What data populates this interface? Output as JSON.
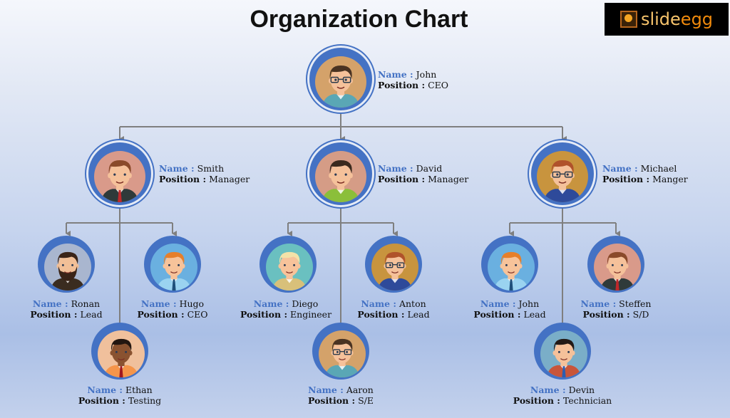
{
  "title": "Organization Chart",
  "logo": {
    "part1": "slide",
    "part2": "egg"
  },
  "labels": {
    "name": "Name :",
    "position": "Position :"
  },
  "colors": {
    "accent": "#4472c4",
    "connector": "#7f7f7f"
  },
  "people": [
    {
      "id": "ceo",
      "name": "John",
      "position": "CEO",
      "level": 0,
      "face": "#d4a26a",
      "shirt": "#5aa7b5",
      "hair": "#4a3322",
      "skin": "#f5c19a",
      "glasses": true
    },
    {
      "id": "m1",
      "name": "Smith",
      "position": "Manager",
      "level": 1,
      "face": "#d99a8a",
      "shirt": "#2f3a3a",
      "hair": "#8a4a2a",
      "skin": "#f5c19a",
      "tie": "#c0282b"
    },
    {
      "id": "m2",
      "name": "David",
      "position": "Manager",
      "level": 1,
      "face": "#d59c86",
      "shirt": "#8bbf3a",
      "hair": "#3b2a1e",
      "skin": "#f5c19a"
    },
    {
      "id": "m3",
      "name": "Michael",
      "position": "Manger",
      "level": 1,
      "face": "#c8943e",
      "shirt": "#2e4a9a",
      "hair": "#b0522a",
      "skin": "#f5c19a",
      "glasses": true
    },
    {
      "id": "r1",
      "name": "Ronan",
      "position": "Lead",
      "level": 2,
      "face": "#a9b6cf",
      "shirt": "#3a2c20",
      "hair": "#3a2418",
      "skin": "#f1bf97",
      "beard": true
    },
    {
      "id": "h1",
      "name": "Hugo",
      "position": "CEO",
      "level": 2,
      "face": "#6ab0e0",
      "shirt": "#9ad3f0",
      "hair": "#e67f2a",
      "skin": "#f7c39a",
      "tie": "#1e4f7a"
    },
    {
      "id": "e1",
      "name": "Ethan",
      "position": "Testing",
      "level": 3,
      "face": "#f0c09c",
      "shirt": "#f5954a",
      "hair": "#231610",
      "skin": "#8a5230",
      "tie": "#a01820"
    },
    {
      "id": "d1",
      "name": "Diego",
      "position": "Engineer",
      "level": 2,
      "face": "#6ac0c0",
      "shirt": "#d8c07a",
      "hair": "#f3e2a8",
      "skin": "#f7c39a"
    },
    {
      "id": "a1",
      "name": "Anton",
      "position": "Lead",
      "level": 2,
      "face": "#c8943e",
      "shirt": "#2e4a9a",
      "hair": "#b0522a",
      "skin": "#f5c19a",
      "glasses": true
    },
    {
      "id": "a2",
      "name": "Aaron",
      "position": "S/E",
      "level": 3,
      "face": "#d4a26a",
      "shirt": "#5aa7b5",
      "hair": "#4a3322",
      "skin": "#f5c19a",
      "glasses": true
    },
    {
      "id": "j2",
      "name": "John",
      "position": "Lead",
      "level": 2,
      "face": "#6ab0e0",
      "shirt": "#9ad3f0",
      "hair": "#e67f2a",
      "skin": "#f7c39a",
      "tie": "#1e4f7a"
    },
    {
      "id": "s1",
      "name": "Steffen",
      "position": "S/D",
      "level": 2,
      "face": "#d99a8a",
      "shirt": "#2f3a3a",
      "hair": "#8a4a2a",
      "skin": "#f5c19a",
      "tie": "#c0282b"
    },
    {
      "id": "dv",
      "name": "Devin",
      "position": "Technician",
      "level": 3,
      "face": "#7aaec8",
      "shirt": "#c8553a",
      "hair": "#231a16",
      "skin": "#f5c19a",
      "tie": "#2d5db0"
    }
  ]
}
